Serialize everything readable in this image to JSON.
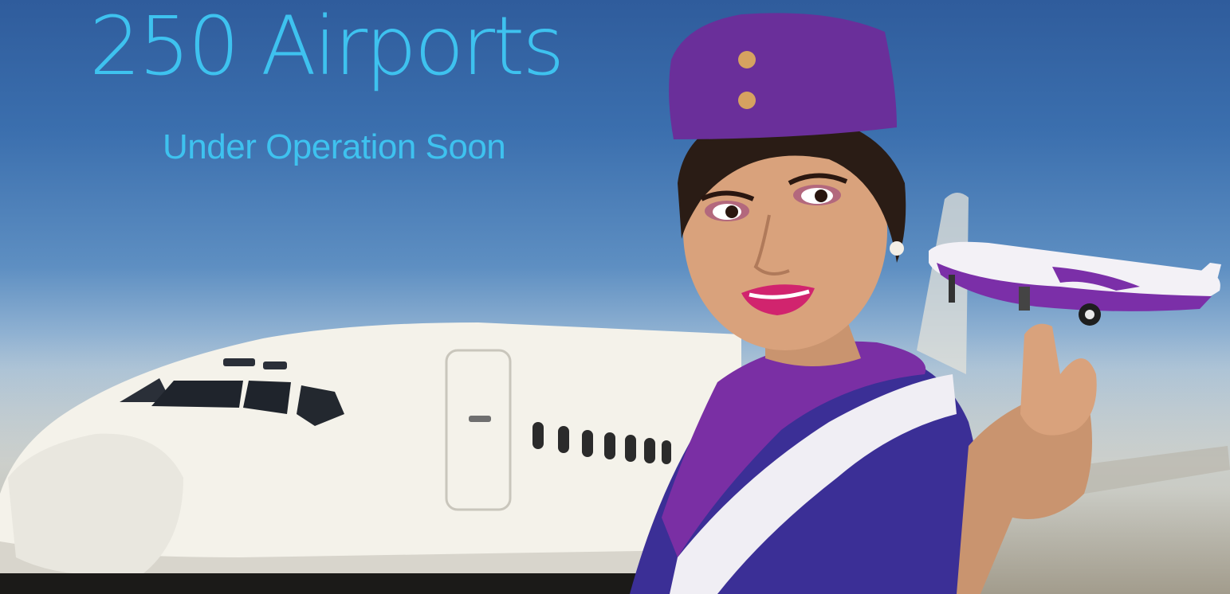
{
  "banner": {
    "headline": "250 Airports",
    "subline": "Under Operation Soon"
  },
  "colors": {
    "text_accent": "#3ec2ef",
    "uniform_purple": "#6a2f9a",
    "uniform_blue": "#3a2f9a",
    "sky_top": "#2f5c9c"
  }
}
